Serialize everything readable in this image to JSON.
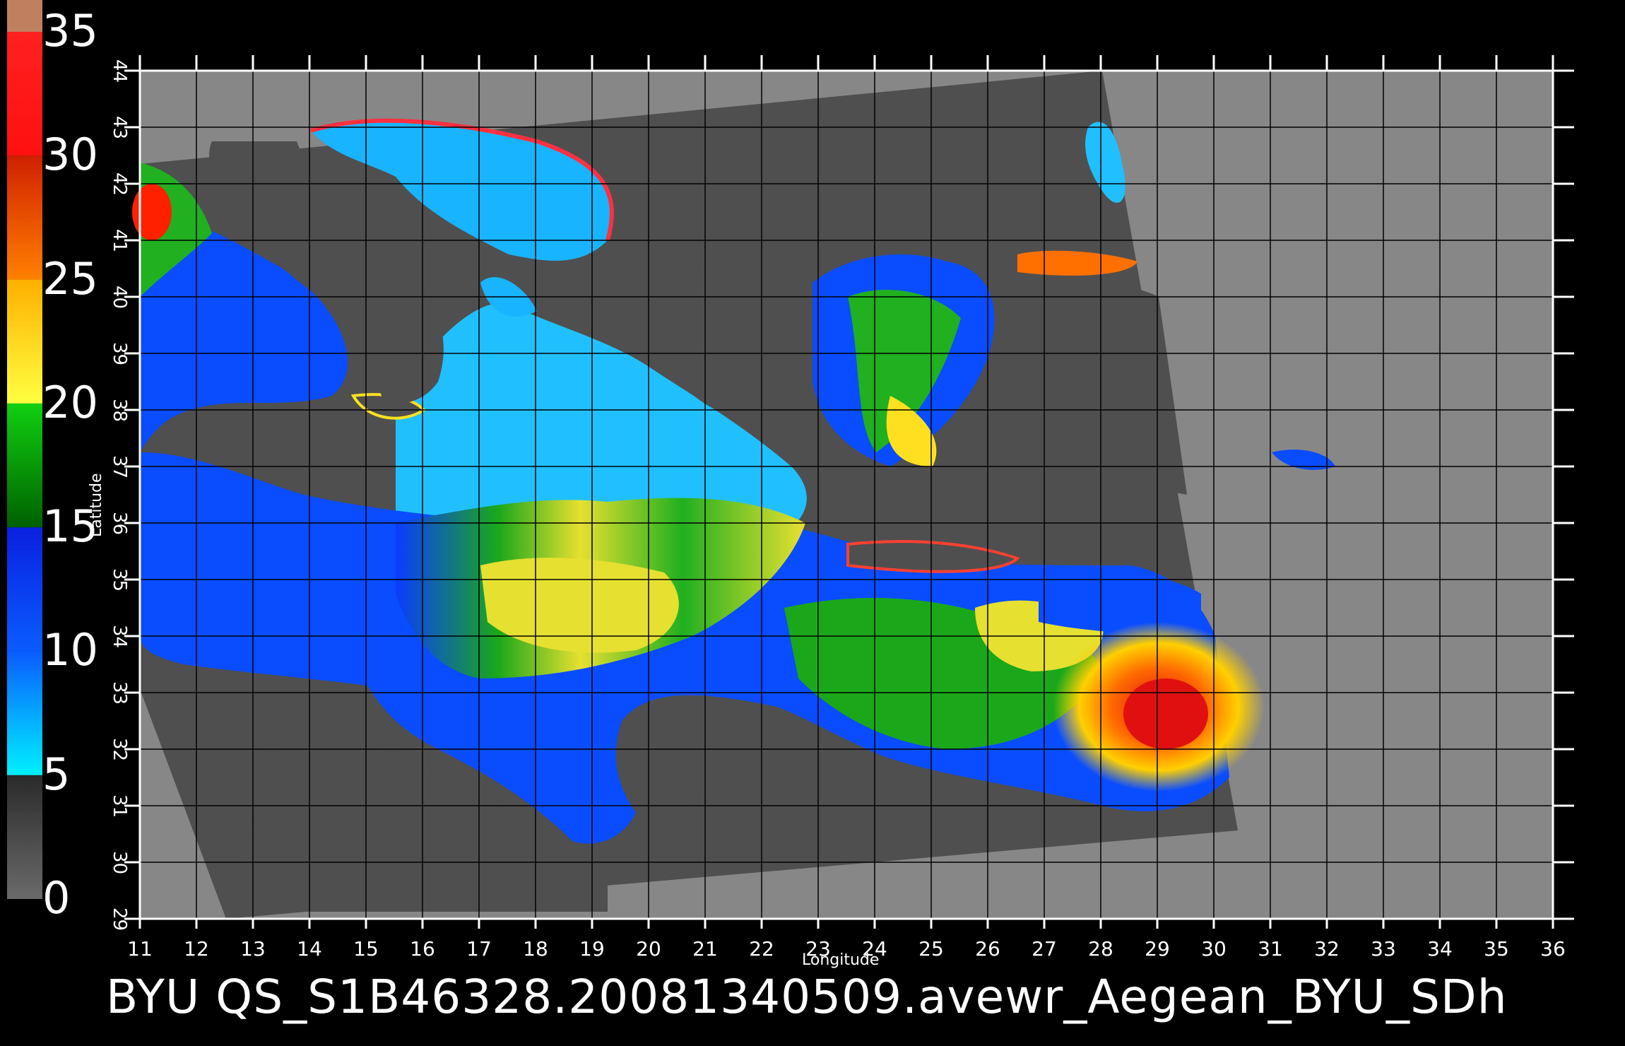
{
  "colorbar": {
    "labels": [
      "35",
      "30",
      "25",
      "20",
      "15",
      "10",
      "5",
      "0"
    ],
    "colors": [
      "#888888",
      "#00e5ff",
      "#0a3cff",
      "#0aa00a",
      "#ffff40",
      "#ffa000",
      "#ff2000",
      "#c08060"
    ]
  },
  "map": {
    "x_ticks": [
      "11",
      "12",
      "13",
      "14",
      "15",
      "16",
      "17",
      "18",
      "19",
      "20",
      "21",
      "22",
      "23",
      "24",
      "25",
      "26",
      "27",
      "28",
      "29",
      "30",
      "31",
      "32",
      "33",
      "34",
      "35",
      "36"
    ],
    "y_ticks": [
      "44",
      "43",
      "42",
      "41",
      "40",
      "39",
      "38",
      "37",
      "36",
      "35",
      "34",
      "33",
      "32",
      "31",
      "30",
      "29"
    ],
    "xlabel": "Longitude",
    "ylabel": "Latitude",
    "lon_range": [
      11,
      36
    ],
    "lat_range": [
      29,
      44
    ],
    "colors": {
      "background_gray": "#878787",
      "swath_gray": "#4f4f4f",
      "grid": "#000000",
      "frame": "#ffffff"
    }
  },
  "caption": "BYU  QS_S1B46328.20081340509.avewr_Aegean_BYU_SDh"
}
